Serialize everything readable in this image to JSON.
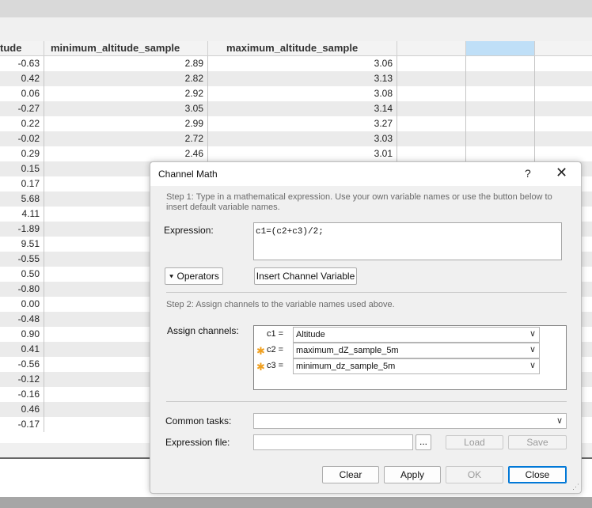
{
  "grid": {
    "columns": [
      "tude",
      "minimum_altitude_sample",
      "maximum_altitude_sample"
    ],
    "rows": [
      [
        "-0.63",
        "2.89",
        "3.06"
      ],
      [
        "0.42",
        "2.82",
        "3.13"
      ],
      [
        "0.06",
        "2.92",
        "3.08"
      ],
      [
        "-0.27",
        "3.05",
        "3.14"
      ],
      [
        "0.22",
        "2.99",
        "3.27"
      ],
      [
        "-0.02",
        "2.72",
        "3.03"
      ],
      [
        "0.29",
        "2.46",
        "3.01"
      ],
      [
        "0.15",
        "",
        ""
      ],
      [
        "0.17",
        "",
        ""
      ],
      [
        "5.68",
        "",
        ""
      ],
      [
        "4.11",
        "",
        ""
      ],
      [
        "-1.89",
        "",
        ""
      ],
      [
        "9.51",
        "",
        ""
      ],
      [
        "-0.55",
        "",
        ""
      ],
      [
        "0.50",
        "",
        ""
      ],
      [
        "-0.80",
        "",
        ""
      ],
      [
        "0.00",
        "",
        ""
      ],
      [
        "-0.48",
        "",
        ""
      ],
      [
        "0.90",
        "",
        ""
      ],
      [
        "0.41",
        "",
        ""
      ],
      [
        "-0.56",
        "",
        ""
      ],
      [
        "-0.12",
        "",
        ""
      ],
      [
        "-0.16",
        "",
        ""
      ],
      [
        "0.46",
        "",
        ""
      ],
      [
        "-0.17",
        "",
        ""
      ]
    ],
    "selected_header_color": "#bfdff7"
  },
  "dialog": {
    "title": "Channel Math",
    "help_label": "?",
    "close_label": "✕",
    "step1_line1": "Step 1: Type in a mathematical expression. Use your own variable names or use the button below to",
    "step1_line2": "insert default variable names.",
    "expression_label": "Expression:",
    "expression_value": "c1=(c2+c3)/2;",
    "operators_label": "Operators",
    "operators_icon": "chevron-double-down",
    "insert_variable_label": "Insert Channel Variable",
    "step2": "Step 2: Assign channels to the variable names used above.",
    "assign_label": "Assign channels:",
    "assignments": [
      {
        "name": "c1 =",
        "value": "Altitude",
        "starred": false
      },
      {
        "name": "c2 =",
        "value": "maximum_dZ_sample_5m",
        "starred": true
      },
      {
        "name": "c3 =",
        "value": "minimum_dz_sample_5m",
        "starred": true
      }
    ],
    "common_tasks_label": "Common tasks:",
    "common_tasks_value": "",
    "expression_file_label": "Expression file:",
    "browse_label": "...",
    "load_label": "Load",
    "save_label": "Save",
    "clear_label": "Clear",
    "apply_label": "Apply",
    "ok_label": "OK",
    "close_button_label": "Close",
    "accent_color": "#0078d7"
  }
}
